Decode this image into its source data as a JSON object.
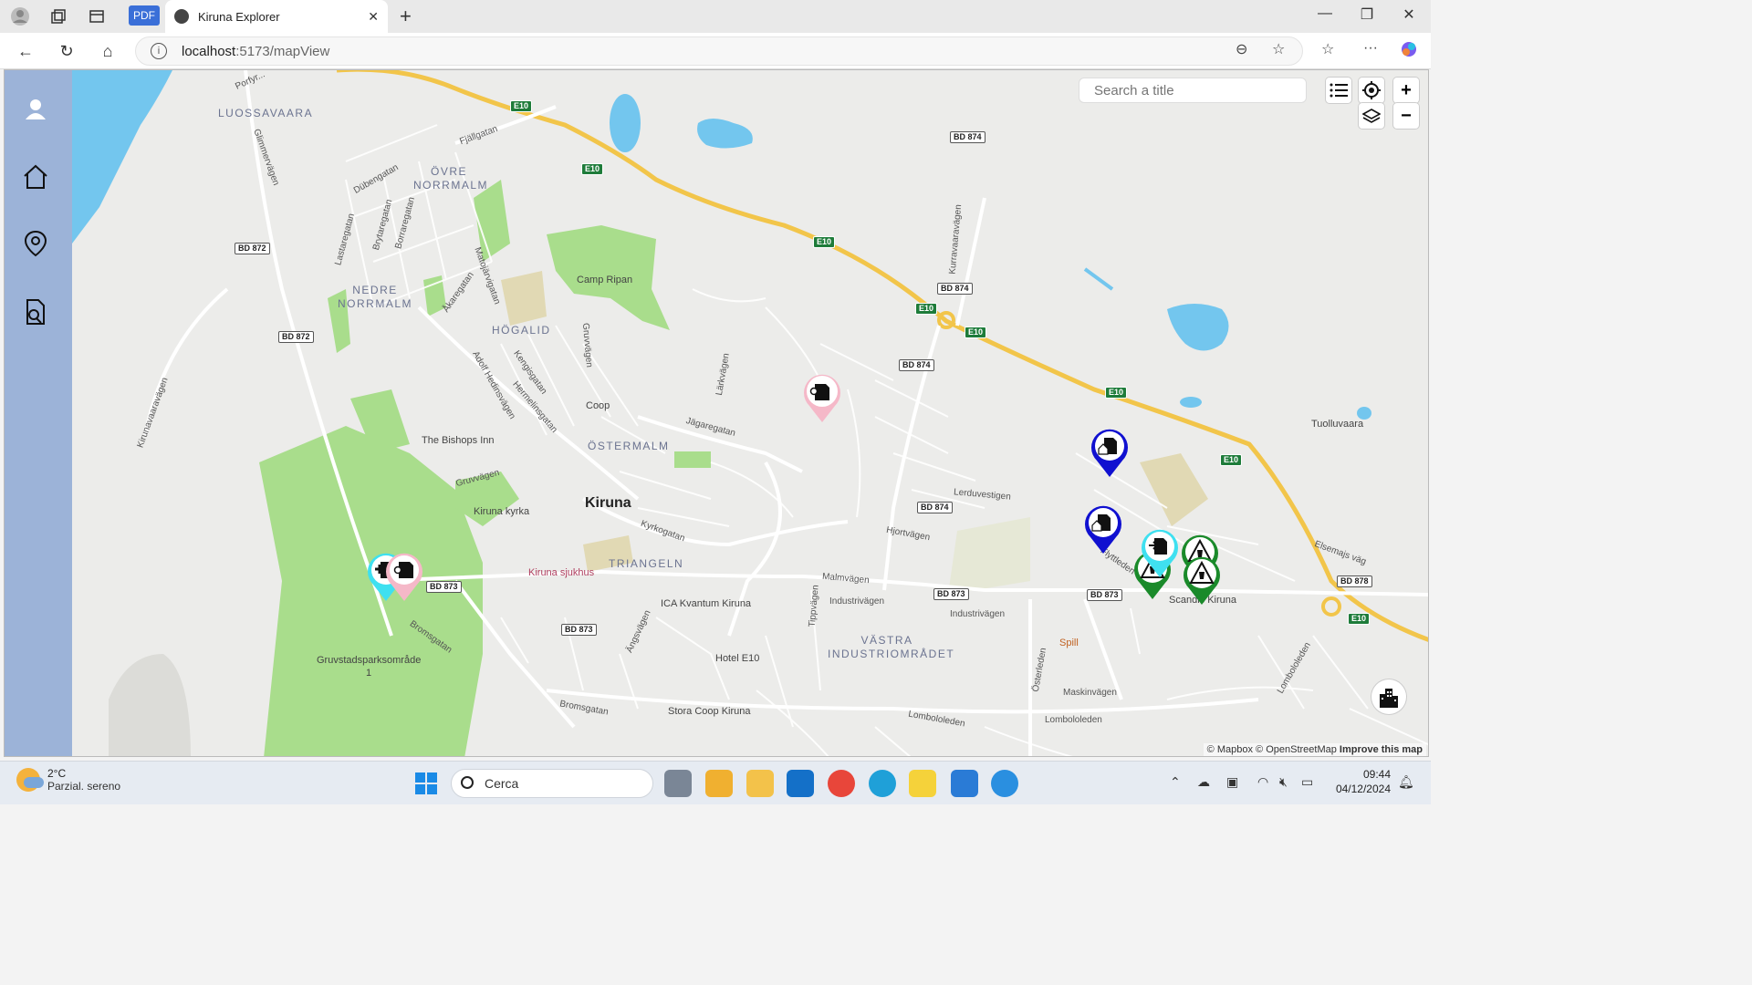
{
  "browser": {
    "tab_title": "Kiruna Explorer",
    "pdf_badge": "PDF",
    "url_host": "localhost",
    "url_path": ":5173/mapView"
  },
  "search": {
    "placeholder": "Search a title"
  },
  "attribution": {
    "mapbox": "© Mapbox",
    "osm": "© OpenStreetMap",
    "improve": "Improve this map"
  },
  "map": {
    "city": "Kiruna",
    "districts": [
      "LUOSSAVAARA",
      "ÖVRE NORRMALM",
      "NEDRE NORRMALM",
      "HÖGALID",
      "ÖSTERMALM",
      "TRIANGELN",
      "VÄSTRA INDUSTRIOMRÅDET"
    ],
    "pois": {
      "camp_ripan": "Camp Ripan",
      "coop": "Coop",
      "bishops_inn": "The Bishops Inn",
      "kiruna_kyrka": "Kiruna kyrka",
      "sjukhus": "Kiruna sjukhus",
      "ica": "ICA Kvantum Kiruna",
      "hotel": "Hotel E10",
      "stora_coop": "Stora Coop Kiruna",
      "gruvstad": "Gruvstadsparksområde",
      "gruvstad_num": "1",
      "spill": "Spill",
      "scandic": "Scandic Kiruna",
      "tuolluvaara": "Tuolluvaara"
    },
    "shields": {
      "e10": "E10",
      "bd872": "BD 872",
      "bd873": "BD 873",
      "bd874": "BD 874",
      "bd878": "BD 878"
    },
    "streets": {
      "fjallgatan": "Fjällgatan",
      "dubengatan": "Dübengatan",
      "glimmervagen": "Glimmervägen",
      "lastaregatan": "Lastaregatan",
      "brytaregatan": "Brytaregatan",
      "borraregatan": "Borraregatan",
      "matojarvigatan": "Matojärvigatan",
      "akaregatan": "Åkaregatan",
      "adolf": "Adolf Hedinsvägen",
      "kengisgatan": "Kengisgatan",
      "hermelinsgatan": "Hermelinsgatan",
      "gruvvagen": "Gruvvägen",
      "jagaregatan": "Jägaregatan",
      "larkvagen": "Lärkvägen",
      "kyrkogatan": "Kyrkogatan",
      "malmvagen": "Malmvägen",
      "industrivagen": "Industrivägen",
      "tippvagen": "Tippvägen",
      "angsvagen": "Ängsvägen",
      "bromsgatan": "Bromsgatan",
      "lombololeden": "Lombololeden",
      "hjortvagen": "Hjortvägen",
      "lerduvestigen": "Lerduvestigen",
      "kurravaaravagen": "Kurravaaravägen",
      "kirunavaaravagen": "Kirunavaaravägen",
      "osterleden": "Österleden",
      "maskinvagen": "Maskinvägen",
      "elsemajs": "Elsemajs väg",
      "flyttleden": "Flyttleden",
      "porfyr": "Porfyr..."
    }
  },
  "markers": [
    {
      "id": "pink-1",
      "color": "#f5b8c8"
    },
    {
      "id": "blue-1",
      "color": "#1010d0"
    },
    {
      "id": "blue-2",
      "color": "#1010d0"
    },
    {
      "id": "cyan-1",
      "color": "#3fe0f0"
    },
    {
      "id": "green-1",
      "color": "#1a8a2a"
    },
    {
      "id": "green-2",
      "color": "#1a8a2a"
    },
    {
      "id": "cyan-pink-cluster",
      "color": "#3fe0f0"
    }
  ],
  "taskbar": {
    "temp": "2°C",
    "weather": "Parzial. sereno",
    "search": "Cerca",
    "time": "09:44",
    "date": "04/12/2024"
  }
}
